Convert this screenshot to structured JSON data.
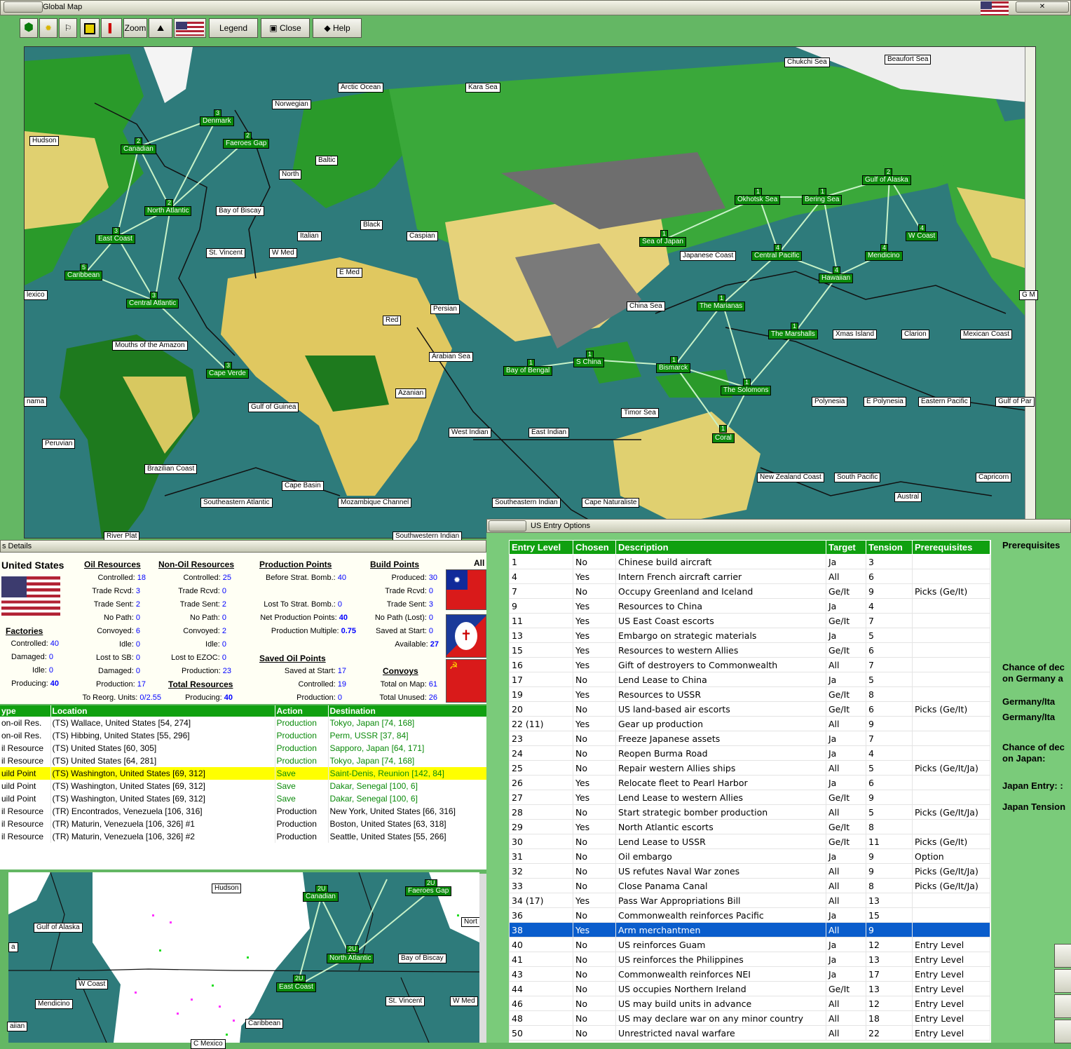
{
  "map_window": {
    "title": "Global Map",
    "toolbar": {
      "zoom": "Zoom",
      "legend": "Legend",
      "close": "Close",
      "help": "Help"
    },
    "labels": [
      "Chukchi Sea",
      "Beaufort Sea",
      "Arctic Ocean",
      "Kara Sea",
      "Norwegian",
      "Hudson",
      "Baltic",
      "North",
      "Bay of Biscay",
      "Black",
      "Caspian",
      "Italian",
      "St. Vincent",
      "W Med",
      "E Med",
      "Red",
      "Persian",
      "lexico",
      "Mouths of the Amazon",
      "Arabian Sea",
      "Azanian",
      "Gulf of Guinea",
      "nama",
      "Peruvian",
      "West Indian",
      "East Indian",
      "Brazilian Coast",
      "Cape Basin",
      "Southeastern Atlantic",
      "Mozambique Channel",
      "Southeastern Indian",
      "Cape Naturaliste",
      "River Plat",
      "Southwestern Indian",
      "Japanese Coast",
      "China Sea",
      "Xmas Island",
      "Clarion",
      "Mexican Coast",
      "G M",
      "Timor Sea",
      "Polynesia",
      "E Polynesia",
      "Eastern Pacific",
      "Gulf of Par",
      "New Zealand Coast",
      "South Pacific",
      "Capricorn",
      "Austral"
    ],
    "sea_zones": [
      {
        "name": "Denmark",
        "n": "3"
      },
      {
        "name": "Canadian",
        "n": "2"
      },
      {
        "name": "Faeroes Gap",
        "n": "2"
      },
      {
        "name": "North Atlantic",
        "n": "2"
      },
      {
        "name": "East Coast",
        "n": "3"
      },
      {
        "name": "Caribbean",
        "n": "5"
      },
      {
        "name": "Central Atlantic",
        "n": "3"
      },
      {
        "name": "Cape Verde",
        "n": "3"
      },
      {
        "name": "Sea of Japan",
        "n": "1"
      },
      {
        "name": "Okhotsk Sea",
        "n": "1"
      },
      {
        "name": "Bering Sea",
        "n": "1"
      },
      {
        "name": "Gulf of Alaska",
        "n": "2"
      },
      {
        "name": "W Coast",
        "n": "4"
      },
      {
        "name": "Mendicino",
        "n": "4"
      },
      {
        "name": "Central Pacific",
        "n": "4"
      },
      {
        "name": "Hawaiian",
        "n": "4"
      },
      {
        "name": "The Marianas",
        "n": "1"
      },
      {
        "name": "The Marshalls",
        "n": "1"
      },
      {
        "name": "Bay of Bengal",
        "n": "1"
      },
      {
        "name": "S China",
        "n": "1"
      },
      {
        "name": "Bismarck",
        "n": "1"
      },
      {
        "name": "The Solomons",
        "n": "1"
      },
      {
        "name": "Coral",
        "n": "1"
      }
    ]
  },
  "details_window": {
    "title": "s Details",
    "country": "United States",
    "headers": {
      "oil": "Oil Resources",
      "nonoil": "Non-Oil Resources",
      "production": "Production Points",
      "build": "Build Points",
      "factories": "Factories",
      "saved_oil": "Saved Oil Points",
      "total_resources": "Total Resources",
      "convoys": "Convoys",
      "all": "All"
    },
    "oil": [
      [
        "Controlled:",
        "18"
      ],
      [
        "Trade Rcvd:",
        "3"
      ],
      [
        "Trade Sent:",
        "2"
      ],
      [
        "No Path:",
        "0"
      ],
      [
        "Convoyed:",
        "6"
      ],
      [
        "Idle:",
        "0"
      ],
      [
        "Lost to SB:",
        "0"
      ],
      [
        "Damaged:",
        "0"
      ],
      [
        "Production:",
        "17"
      ],
      [
        "To Reorg. Units:",
        "0/2.55"
      ]
    ],
    "nonoil": [
      [
        "Controlled:",
        "25"
      ],
      [
        "Trade Rcvd:",
        "0"
      ],
      [
        "Trade Sent:",
        "2"
      ],
      [
        "No Path:",
        "0"
      ],
      [
        "Convoyed:",
        "2"
      ],
      [
        "Idle:",
        "0"
      ],
      [
        "Lost to EZOC:",
        "0"
      ],
      [
        "Production:",
        "23"
      ],
      [
        "Producing:",
        "40"
      ]
    ],
    "production": [
      [
        "Before Strat. Bomb.:",
        "40"
      ],
      [
        "Lost To Strat. Bomb.:",
        "0"
      ],
      [
        "Net Production Points:",
        "40"
      ],
      [
        "Production Multiple:",
        "0.75"
      ]
    ],
    "saved_oil": [
      [
        "Saved at Start:",
        "17"
      ],
      [
        "Controlled:",
        "19"
      ],
      [
        "Production:",
        "0"
      ]
    ],
    "build": [
      [
        "Produced:",
        "30"
      ],
      [
        "Trade Rcvd:",
        "0"
      ],
      [
        "Trade Sent:",
        "3"
      ],
      [
        "No Path (Lost):",
        "0"
      ],
      [
        "Saved at Start:",
        "0"
      ],
      [
        "Available:",
        "27"
      ]
    ],
    "convoys": [
      [
        "Total on Map:",
        "61"
      ],
      [
        "Total Unused:",
        "26"
      ]
    ],
    "factories": [
      [
        "Controlled:",
        "40"
      ],
      [
        "Damaged:",
        "0"
      ],
      [
        "Idle:",
        "0"
      ],
      [
        "Producing:",
        "40"
      ]
    ],
    "table": {
      "columns": [
        "ype",
        "Location",
        "Action",
        "Destination"
      ],
      "rows": [
        [
          "on-oil Res.",
          "(TS) Wallace, United States [54, 274]",
          "Production",
          "Tokyo, Japan [74, 168]"
        ],
        [
          "on-oil Res.",
          "(TS) Hibbing, United States [55, 296]",
          "Production",
          "Perm, USSR [37, 84]"
        ],
        [
          "il Resource",
          "(TS) United States [60, 305]",
          "Production",
          "Sapporo, Japan [64, 171]"
        ],
        [
          "il Resource",
          "(TS) United States [64, 281]",
          "Production",
          "Tokyo, Japan [74, 168]"
        ],
        [
          "uild Point",
          "(TS) Washington, United States [69, 312]",
          "Save",
          "Saint-Denis, Reunion [142, 84]"
        ],
        [
          "uild Point",
          "(TS) Washington, United States [69, 312]",
          "Save",
          "Dakar, Senegal [100, 6]"
        ],
        [
          "uild Point",
          "(TS) Washington, United States [69, 312]",
          "Save",
          "Dakar, Senegal [100, 6]"
        ],
        [
          "il Resource",
          "(TR) Encontrados, Venezuela [106, 316]",
          "Production",
          "New York, United States [66, 316]"
        ],
        [
          "il Resource",
          "(TR) Maturin, Venezuela [106, 326] #1",
          "Production",
          "Boston, United States [63, 318]"
        ],
        [
          "il Resource",
          "(TR) Maturin, Venezuela [106, 326] #2",
          "Production",
          "Seattle, United States [55, 266]"
        ]
      ]
    }
  },
  "mini_map": {
    "labels": [
      "Hudson",
      "Gulf of Alaska",
      "Bay of Biscay",
      "W Coast",
      "Mendicino",
      "St. Vincent",
      "W Med",
      "Caribbean",
      "Nort",
      "a",
      "aiian",
      "C Mexico"
    ],
    "sea_zones": [
      {
        "name": "Canadian",
        "n": "2U"
      },
      {
        "name": "Faeroes Gap",
        "n": "2U"
      },
      {
        "name": "North Atlantic",
        "n": "2U"
      },
      {
        "name": "East Coast",
        "n": "2U"
      }
    ]
  },
  "entry_window": {
    "title": "US Entry Options",
    "columns": [
      "Entry Level",
      "Chosen",
      "Description",
      "Target",
      "Tension",
      "Prerequisites"
    ],
    "rows": [
      [
        "1",
        "No",
        "Chinese build aircraft",
        "Ja",
        "3",
        ""
      ],
      [
        "4",
        "Yes",
        "Intern French aircraft carrier",
        "All",
        "6",
        ""
      ],
      [
        "7",
        "No",
        "Occupy Greenland and Iceland",
        "Ge/It",
        "9",
        "Picks (Ge/It)"
      ],
      [
        "9",
        "Yes",
        "Resources to China",
        "Ja",
        "4",
        ""
      ],
      [
        "11",
        "Yes",
        "US East Coast escorts",
        "Ge/It",
        "7",
        ""
      ],
      [
        "13",
        "Yes",
        "Embargo on strategic materials",
        "Ja",
        "5",
        ""
      ],
      [
        "15",
        "Yes",
        "Resources to western Allies",
        "Ge/It",
        "6",
        ""
      ],
      [
        "16",
        "Yes",
        "Gift of destroyers to Commonwealth",
        "All",
        "7",
        ""
      ],
      [
        "17",
        "No",
        "Lend Lease to China",
        "Ja",
        "5",
        ""
      ],
      [
        "19",
        "Yes",
        "Resources to USSR",
        "Ge/It",
        "8",
        ""
      ],
      [
        "20",
        "No",
        "US land-based air escorts",
        "Ge/It",
        "6",
        "Picks (Ge/It)"
      ],
      [
        "22 (11)",
        "Yes",
        "Gear up production",
        "All",
        "9",
        ""
      ],
      [
        "23",
        "No",
        "Freeze Japanese assets",
        "Ja",
        "7",
        ""
      ],
      [
        "24",
        "No",
        "Reopen Burma Road",
        "Ja",
        "4",
        ""
      ],
      [
        "25",
        "No",
        "Repair western Allies ships",
        "All",
        "5",
        "Picks (Ge/It/Ja)"
      ],
      [
        "26",
        "Yes",
        "Relocate fleet to Pearl Harbor",
        "Ja",
        "6",
        ""
      ],
      [
        "27",
        "Yes",
        "Lend Lease to western Allies",
        "Ge/It",
        "9",
        ""
      ],
      [
        "28",
        "No",
        "Start strategic bomber production",
        "All",
        "5",
        "Picks (Ge/It/Ja)"
      ],
      [
        "29",
        "Yes",
        "North Atlantic escorts",
        "Ge/It",
        "8",
        ""
      ],
      [
        "30",
        "No",
        "Lend Lease to USSR",
        "Ge/It",
        "11",
        "Picks (Ge/It)"
      ],
      [
        "31",
        "No",
        "Oil embargo",
        "Ja",
        "9",
        "Option"
      ],
      [
        "32",
        "No",
        "US refutes Naval War zones",
        "All",
        "9",
        "Picks (Ge/It/Ja)"
      ],
      [
        "33",
        "No",
        "Close Panama Canal",
        "All",
        "8",
        "Picks (Ge/It/Ja)"
      ],
      [
        "34 (17)",
        "Yes",
        "Pass War Appropriations Bill",
        "All",
        "13",
        ""
      ],
      [
        "36",
        "No",
        "Commonwealth reinforces Pacific",
        "Ja",
        "15",
        ""
      ],
      [
        "38",
        "Yes",
        "Arm merchantmen",
        "All",
        "9",
        ""
      ],
      [
        "40",
        "No",
        "US reinforces Guam",
        "Ja",
        "12",
        "Entry Level"
      ],
      [
        "41",
        "No",
        "US reinforces the Philippines",
        "Ja",
        "13",
        "Entry Level"
      ],
      [
        "43",
        "No",
        "Commonwealth reinforces NEI",
        "Ja",
        "17",
        "Entry Level"
      ],
      [
        "44",
        "No",
        "US occupies Northern Ireland",
        "Ge/It",
        "13",
        "Entry Level"
      ],
      [
        "46",
        "No",
        "US may build units in advance",
        "All",
        "12",
        "Entry Level"
      ],
      [
        "48",
        "No",
        "US may declare war on any minor country",
        "All",
        "18",
        "Entry Level"
      ],
      [
        "50",
        "No",
        "Unrestricted naval warfare",
        "All",
        "22",
        "Entry Level"
      ]
    ],
    "selected_index": 25,
    "side": {
      "prereq": "Prerequisites",
      "chance1a": "Chance of dec",
      "chance1b": "on Germany a",
      "geit1": "Germany/Ita",
      "geit2": "Germany/Ita",
      "chance2a": "Chance of dec",
      "chance2b": "on Japan:",
      "japan_entry": "Japan Entry: :",
      "japan_tension": "Japan Tension"
    }
  }
}
